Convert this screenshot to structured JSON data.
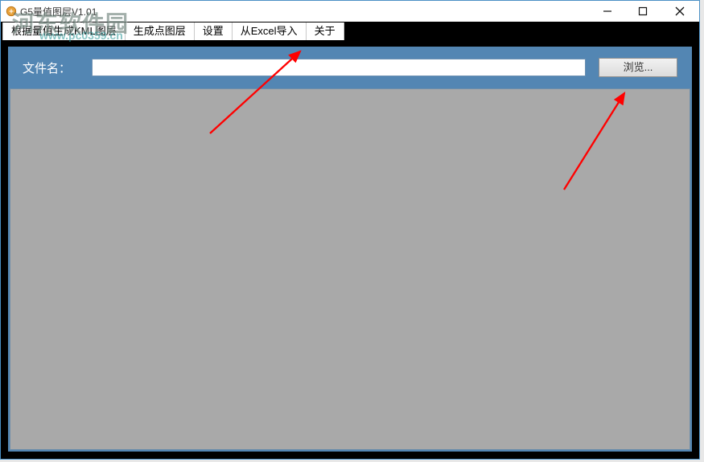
{
  "window": {
    "title": "G5量值图层V1.01"
  },
  "menu": {
    "items": [
      {
        "label": "根据量值生成KML图层"
      },
      {
        "label": "生成点图层"
      },
      {
        "label": "设置"
      },
      {
        "label": "从Excel导入"
      },
      {
        "label": "关于"
      }
    ],
    "active_index": 3
  },
  "file_row": {
    "label": "文件名：",
    "value": "",
    "browse": "浏览..."
  },
  "watermark": {
    "text": "河东软件园",
    "url": "www.pc0359.cn"
  }
}
